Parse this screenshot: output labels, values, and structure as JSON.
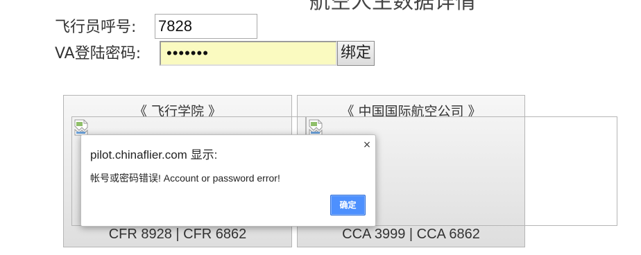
{
  "header": {
    "title": "航空人生数据详情"
  },
  "form": {
    "callsign_label": "飞行员呼号:",
    "callsign_value": "7828",
    "password_label": "VA登陆密码:",
    "password_value": "•••••••",
    "bind_button_label": "绑定"
  },
  "cards": [
    {
      "title": "《 飞行学院 》",
      "footer": "CFR 8928 | CFR 6862"
    },
    {
      "title": "《 中国国际航空公司 》",
      "footer": "CCA 3999 | CCA 6862"
    }
  ],
  "dialog": {
    "title": "pilot.chinaflier.com 显示:",
    "message": "帐号或密码错误!  Account or password error!",
    "close_symbol": "×",
    "ok_label": "确定"
  },
  "colors": {
    "password_field_bg": "#fafac0",
    "ok_button_bg": "#4d90fe"
  },
  "icons": {
    "broken_image": "broken-image-icon",
    "close": "close-icon"
  }
}
